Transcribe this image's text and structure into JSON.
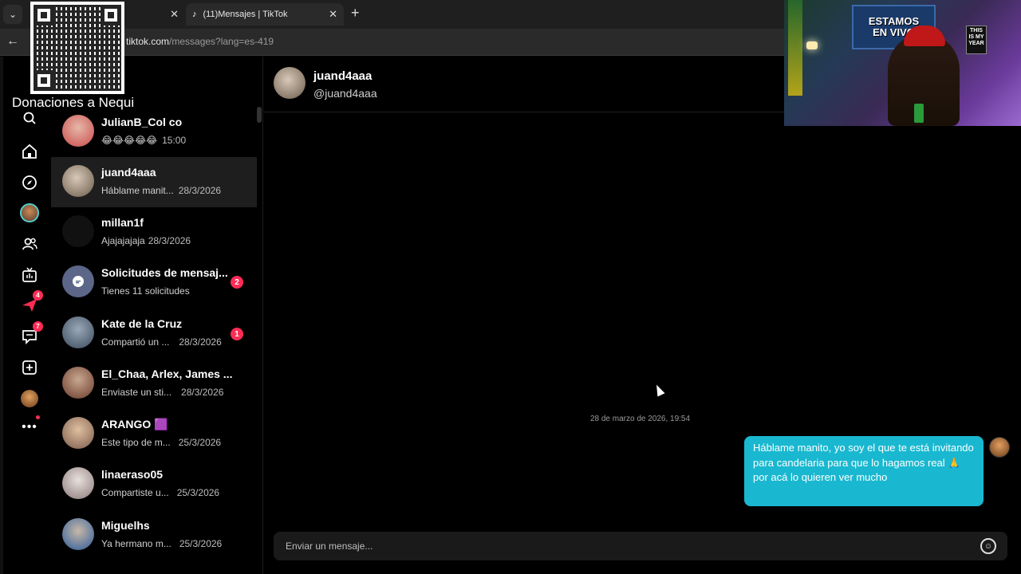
{
  "browser": {
    "tabs": [
      {
        "label": "",
        "active": false
      },
      {
        "label": "(11)Mensajes | TikTok",
        "active": true
      }
    ],
    "url_host": "tiktok.com",
    "url_path": "/messages?lang=es-419"
  },
  "overlay": {
    "donation_label": "Donaciones a Nequi",
    "webcam_sign_line1": "ESTAMOS",
    "webcam_sign_line2": "EN VIVO",
    "webcam_poster": "THIS IS MY YEAR"
  },
  "rail": {
    "items": [
      {
        "name": "search",
        "badge": ""
      },
      {
        "name": "home",
        "badge": ""
      },
      {
        "name": "explore",
        "badge": ""
      },
      {
        "name": "following-avatar",
        "badge": ""
      },
      {
        "name": "friends",
        "badge": ""
      },
      {
        "name": "live",
        "badge": ""
      },
      {
        "name": "activity",
        "badge": "4"
      },
      {
        "name": "messages",
        "badge": "7"
      },
      {
        "name": "upload",
        "badge": ""
      },
      {
        "name": "profile",
        "badge": ""
      },
      {
        "name": "more",
        "badge": ""
      }
    ]
  },
  "conversations": [
    {
      "name": "JulianB_Col co",
      "preview": "😂😂😂😂😂",
      "time": "15:00",
      "badge": "",
      "avatar_color": "#c94a4a"
    },
    {
      "name": "juand4aaa",
      "preview": "Háblame manit...",
      "time": "28/3/2026",
      "badge": "",
      "avatar_color": "#8a7a6a",
      "selected": true
    },
    {
      "name": "millan1f",
      "preview": "Ajajajajaja",
      "time": "28/3/2026",
      "badge": "",
      "avatar_color": "#111111"
    },
    {
      "name": "Solicitudes de mensaj...",
      "preview": "Tienes 11 solicitudes",
      "time": "",
      "badge": "2",
      "avatar_color": "#5b6688"
    },
    {
      "name": "Kate de la Cruz",
      "preview": "Compartió un ...",
      "time": "28/3/2026",
      "badge": "1",
      "avatar_color": "#4a5a6a"
    },
    {
      "name": "El_Chaa, Arlex, James ...",
      "preview": "Enviaste un sti...",
      "time": "28/3/2026",
      "badge": "",
      "avatar_color": "#6a4a3a"
    },
    {
      "name": "ARANGO 🟪",
      "preview": "Este tipo de m...",
      "time": "25/3/2026",
      "badge": "",
      "avatar_color": "#8a6a5a"
    },
    {
      "name": "linaeraso05",
      "preview": "Compartiste u...",
      "time": "25/3/2026",
      "badge": "",
      "avatar_color": "#9a8a8a"
    },
    {
      "name": "Miguelhs",
      "preview": "Ya hermano m...",
      "time": "25/3/2026",
      "badge": "",
      "avatar_color": "#3a6aaa"
    }
  ],
  "chat": {
    "name": "juand4aaa",
    "handle": "@juand4aaa",
    "date_separator": "28 de marzo de 2026, 19:54",
    "message": "Háblame manito, yo soy el que te está invitando para candelaria para que lo hagamos real 🙏 por acá lo quieren ver mucho",
    "composer_placeholder": "Enviar un mensaje..."
  },
  "colors": {
    "accent_badge": "#fe2c55",
    "bubble": "#19b8d0",
    "selected_row": "#1e1e1e"
  }
}
